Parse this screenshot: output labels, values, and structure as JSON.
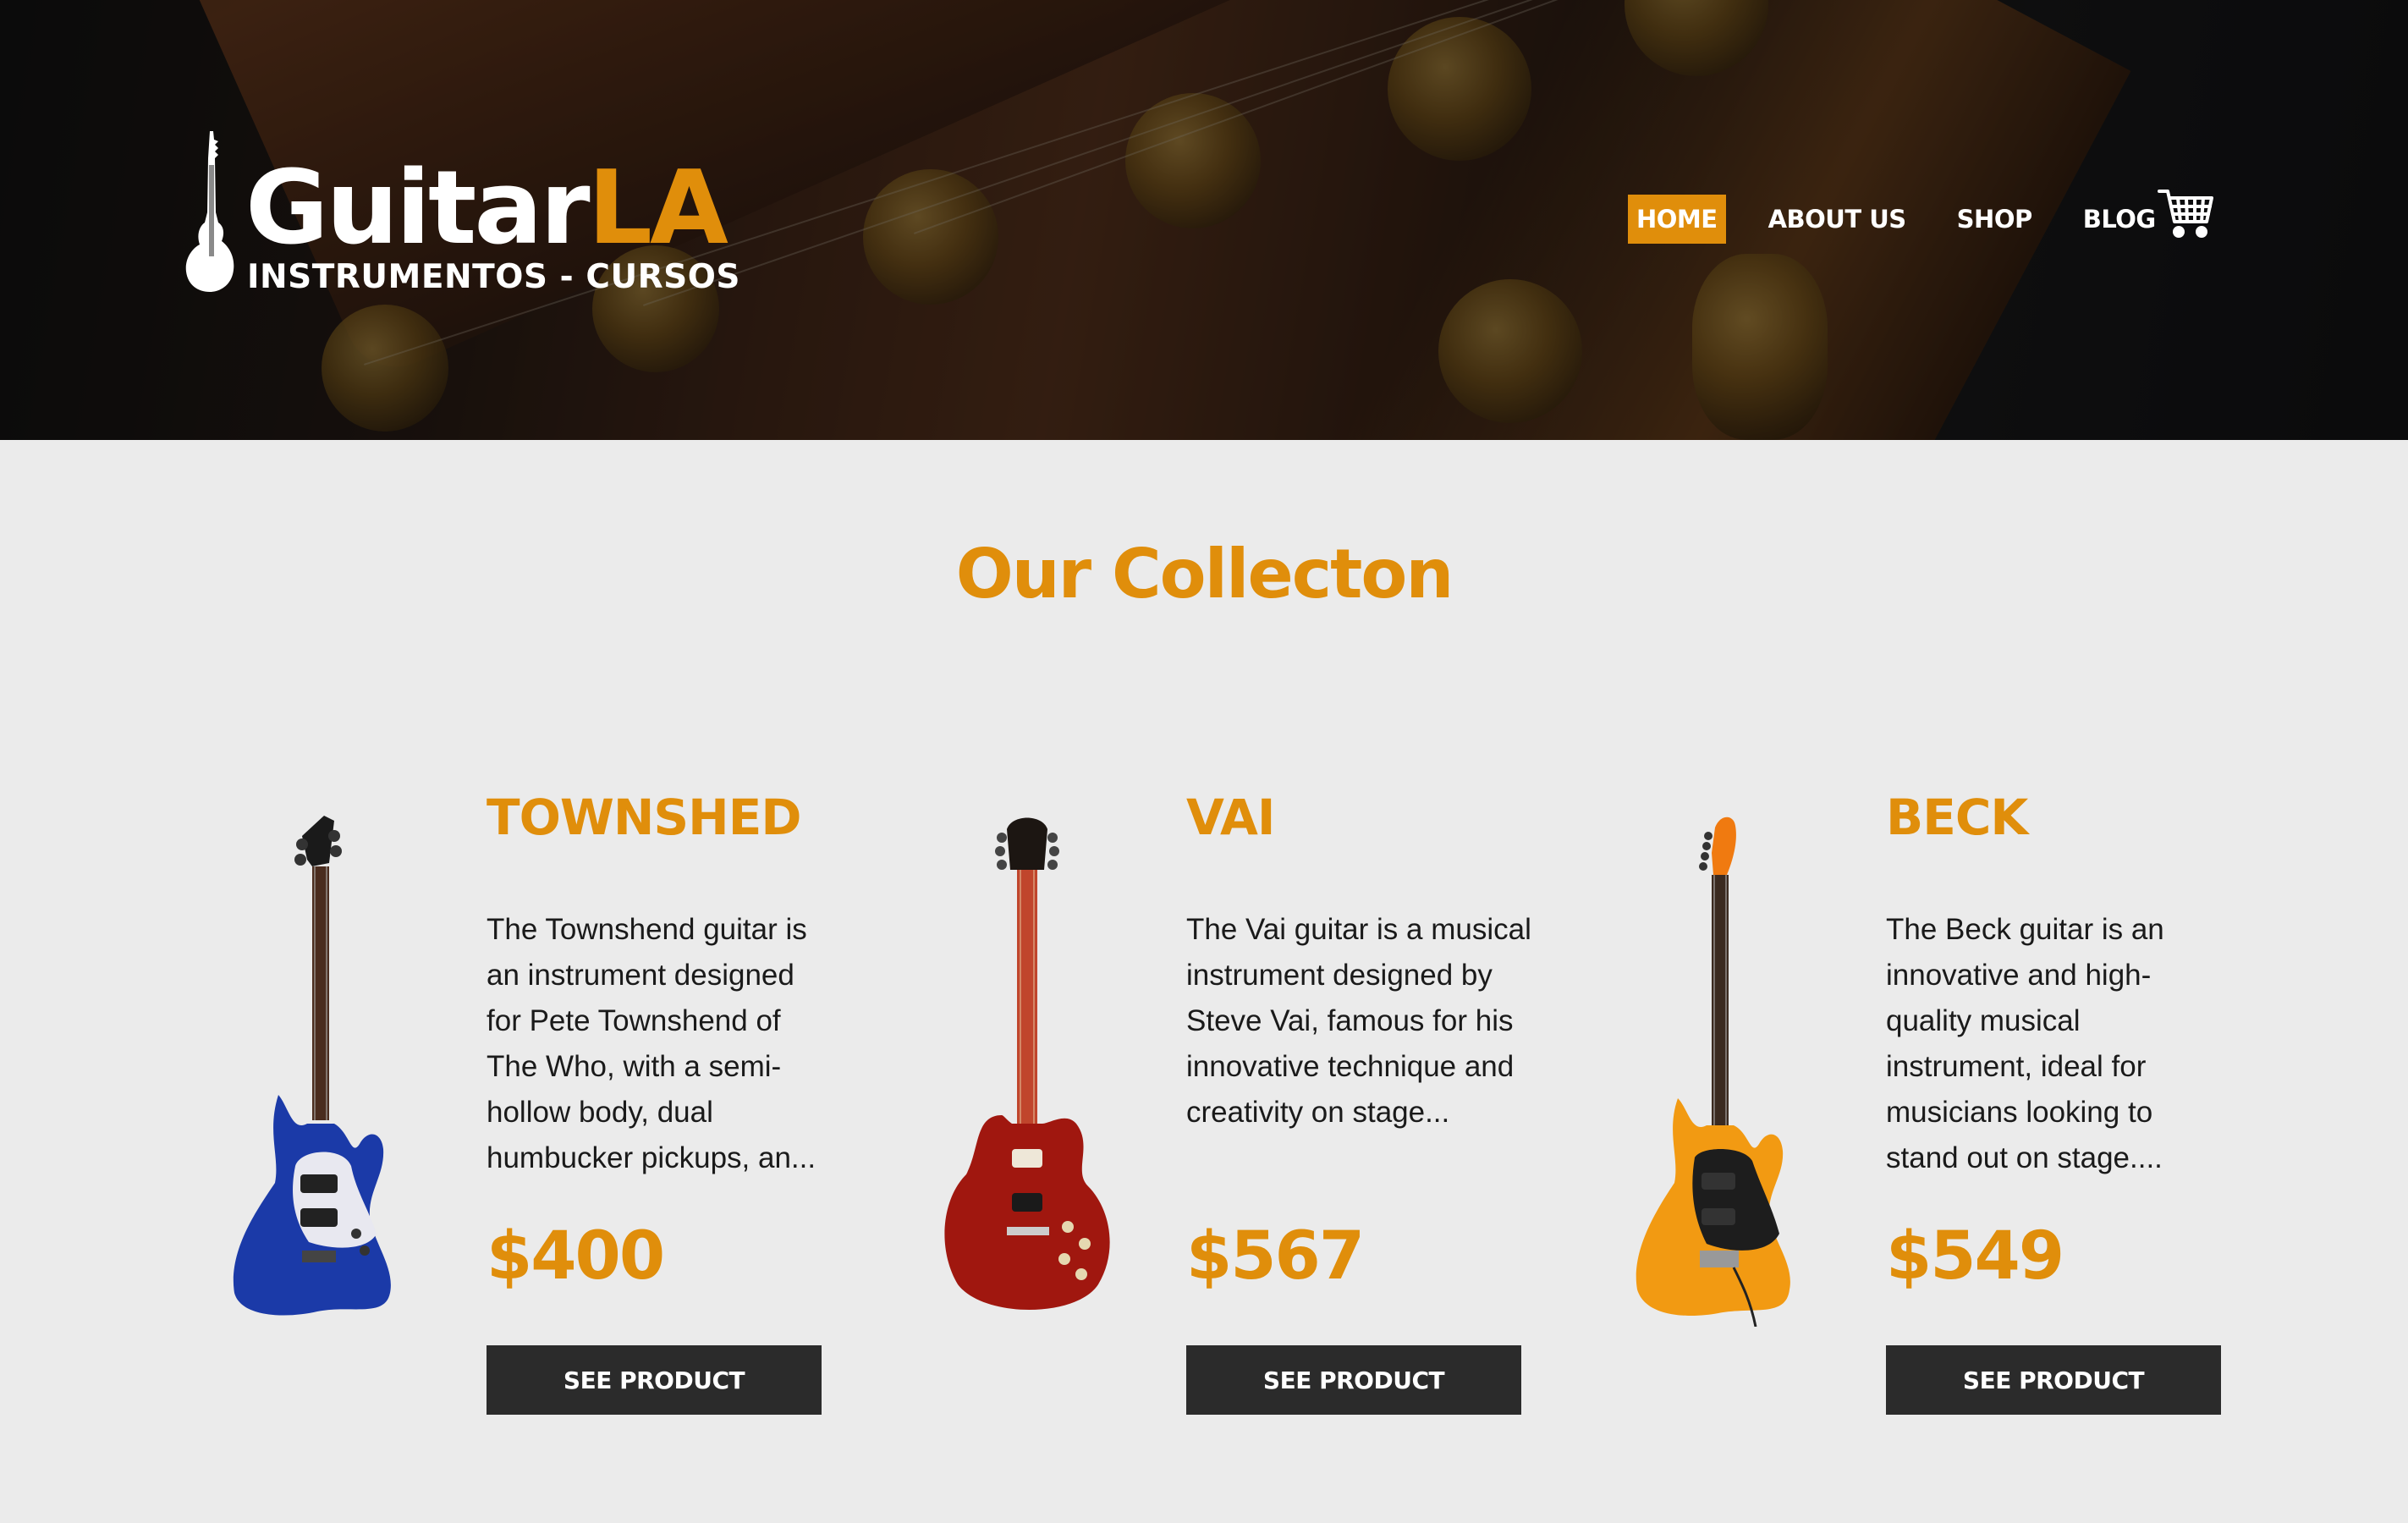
{
  "header": {
    "logo": {
      "word_primary": "Guitar",
      "word_accent": "LA",
      "tagline": "INSTRUMENTOS - CURSOS",
      "icon": "guitar-silhouette-icon"
    },
    "nav": [
      {
        "label": "HOME",
        "active": true
      },
      {
        "label": "ABOUT US",
        "active": false
      },
      {
        "label": "SHOP",
        "active": false
      },
      {
        "label": "BLOG",
        "active": false
      }
    ],
    "cart_icon": "shopping-cart-icon"
  },
  "main": {
    "title": "Our Collecton",
    "products": [
      {
        "name": "TOWNSHED",
        "description": "The Townshend guitar is an instrument designed for Pete Townshend of The Who, with a semi-hollow body, dual humbucker pickups, an...",
        "price": "$400",
        "button": "SEE PRODUCT",
        "image": "blue-electric-guitar-image"
      },
      {
        "name": "VAI",
        "description": "The Vai guitar is a musical instrument designed by Steve Vai, famous for his innovative technique and creativity on stage...",
        "price": "$567",
        "button": "SEE PRODUCT",
        "image": "red-electric-guitar-image"
      },
      {
        "name": "BECK",
        "description": "The Beck guitar is an innovative and high-quality musical instrument, ideal for musicians looking to stand out on stage....",
        "price": "$549",
        "button": "SEE PRODUCT",
        "image": "orange-electric-guitar-image"
      }
    ]
  },
  "colors": {
    "accent": "#e08e0b",
    "background": "#ebebeb",
    "button": "#2b2b2b",
    "text": "#1a1a1a"
  }
}
